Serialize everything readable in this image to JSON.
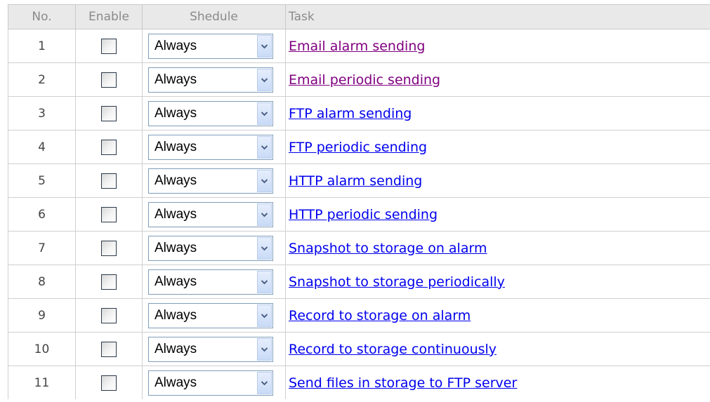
{
  "table": {
    "headers": {
      "no": "No.",
      "enable": "Enable",
      "schedule": "Shedule",
      "task": "Task"
    },
    "rows": [
      {
        "no": "1",
        "enabled": false,
        "schedule": "Always",
        "task": "Email alarm sending",
        "visited": true
      },
      {
        "no": "2",
        "enabled": false,
        "schedule": "Always",
        "task": "Email periodic sending",
        "visited": true
      },
      {
        "no": "3",
        "enabled": false,
        "schedule": "Always",
        "task": "FTP alarm sending",
        "visited": false
      },
      {
        "no": "4",
        "enabled": false,
        "schedule": "Always",
        "task": "FTP periodic sending",
        "visited": false
      },
      {
        "no": "5",
        "enabled": false,
        "schedule": "Always",
        "task": "HTTP alarm sending",
        "visited": false
      },
      {
        "no": "6",
        "enabled": false,
        "schedule": "Always",
        "task": "HTTP periodic sending",
        "visited": false
      },
      {
        "no": "7",
        "enabled": false,
        "schedule": "Always",
        "task": "Snapshot to storage on alarm",
        "visited": false
      },
      {
        "no": "8",
        "enabled": false,
        "schedule": "Always",
        "task": "Snapshot to storage periodically",
        "visited": false
      },
      {
        "no": "9",
        "enabled": false,
        "schedule": "Always",
        "task": "Record to storage on alarm",
        "visited": false
      },
      {
        "no": "10",
        "enabled": false,
        "schedule": "Always",
        "task": "Record to storage continuously",
        "visited": false
      },
      {
        "no": "11",
        "enabled": false,
        "schedule": "Always",
        "task": "Send files in storage to FTP server",
        "visited": false
      }
    ]
  },
  "icons": {
    "dropdown": "chevron-down-icon"
  },
  "colors": {
    "header_bg": "#e9e9e9",
    "header_text": "#8a8a8a",
    "link": "#0000ee",
    "visited_link": "#800080"
  }
}
